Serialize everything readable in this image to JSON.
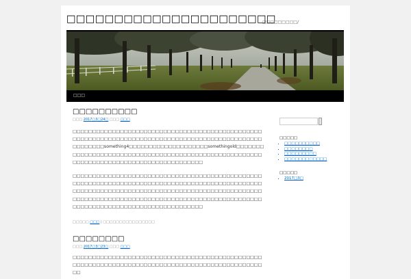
{
  "site": {
    "title": "□□□□□□□□□□□□□□□□□□□□□□",
    "description": "□□□□□□□□□/"
  },
  "nav": {
    "home_label": "□□□"
  },
  "posts": [
    {
      "title": "□□□□□□□□□□",
      "meta_prefix": "□□□ ",
      "date": "2017□3□24□",
      "meta_mid": " □□□ ",
      "author": "□□□",
      "paragraphs": [
        "□□□□□□□□□□□□□□□□□□□□□□□□□□□□□□□□□□□□□□□□□□□□□□□□□□□□□□□□□□□□□□□□□□□□□□□□□□□□□□□□□□□□□□□□□□□□□□□□□□□□□□□□something4□□□□□□□□□□□□□□□□□□□□somethingold□□□□□□□□□□□□□□□□□□□□□□□□□□□□□□□□□□□□□□□□□□□□□□□□□□□□□□□□□□□□□□□□□□□□□□□□□□□□□□□□□□□□□□□□",
        "□□□□□□□□□□□□□□□□□□□□□□□□□□□□□□□□□□□□□□□□□□□□□□□□□□□□□□□□□□□□□□□□□□□□□□□□□□□□□□□□□□□□□□□□□□□□□□□□□□□□□□□□□□□□□□□□□□□□□□□□□□□□□□□□□□□□□□□□□□□□□□□□□□□□□□□□□□□□□□□□□□□□□□□□□□□□□□□□□□□□□□□□□□□□□□□□□□□□□□□□□□□□□□□□□□□□□□□□□□□□□□□□□"
      ],
      "util_prefix": "□□□□□ ",
      "util_category": "□□□",
      "util_suffix": " | □□□□□□□□□□□□□□□□"
    },
    {
      "title": "□□□□□□□□",
      "meta_prefix": "□□□ ",
      "date": "2017□3□23□",
      "meta_mid": " □□□ ",
      "author": "□□□",
      "paragraphs": [
        "□□□□□□□□□□□□□□□□□□□□□□□□□□□□□□□□□□□□□□□□□□□□□□□□□□□□□□□□□□□□□□□□□□□□□□□□□□□□□□□□□□□□□□□□□□□□□□□□□□"
      ]
    }
  ],
  "sidebar": {
    "search_value": "",
    "recent_title": "□□□□□",
    "recent": [
      "□□□□□□□□□□",
      "□□□□□□□□",
      "□□□□□□□□□",
      "□□□□□□□□□□□□"
    ],
    "archive_title": "□□□□□",
    "archives": [
      "2017□3□"
    ]
  }
}
